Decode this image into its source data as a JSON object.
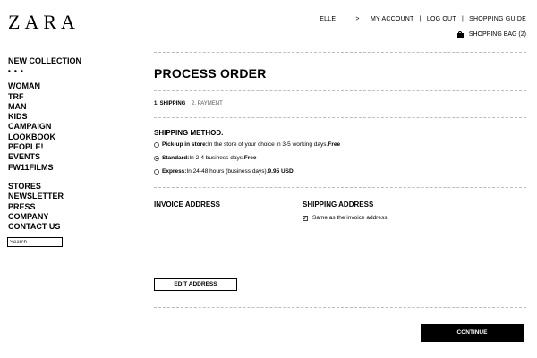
{
  "header": {
    "logo": "ZARA",
    "nav": [
      {
        "label": "ELLE"
      },
      {
        "label": ">",
        "separator": true
      },
      {
        "label": "MY ACCOUNT"
      },
      {
        "label": "|",
        "separator": true
      },
      {
        "label": "LOG OUT"
      },
      {
        "label": "|",
        "separator": true
      },
      {
        "label": "SHOPPING GUIDE"
      }
    ],
    "bag_icon": "shopping-bag-icon",
    "bag_label": "SHOPPING BAG (2)"
  },
  "sidebar": {
    "items": [
      {
        "label": "NEW COLLECTION"
      },
      {
        "label": "• • •"
      },
      {
        "label": "WOMAN"
      },
      {
        "label": "TRF"
      },
      {
        "label": "MAN"
      },
      {
        "label": "KIDS"
      },
      {
        "label": "CAMPAIGN"
      },
      {
        "label": "LOOKBOOK"
      },
      {
        "label": "PEOPLE!"
      },
      {
        "label": "EVENTS"
      },
      {
        "label": "FW11FILMS"
      },
      {
        "label": "STORES"
      },
      {
        "label": "NEWSLETTER"
      },
      {
        "label": "PRESS"
      },
      {
        "label": "COMPANY"
      },
      {
        "label": "CONTACT US"
      }
    ],
    "search_value": "Search..."
  },
  "main": {
    "title": "PROCESS ORDER",
    "steps": {
      "step1": "1. SHIPPING",
      "step2": "2. PAYMENT"
    },
    "shipping_method": {
      "title": "SHIPPING METHOD.",
      "options": [
        {
          "name": "Pick-up in store:",
          "desc": " In the store of your choice in 3-5 working days. ",
          "price": "Free",
          "selected": false
        },
        {
          "name": "Standard:",
          "desc": " In 2-4 business days. ",
          "price": "Free",
          "selected": true
        },
        {
          "name": "Express:",
          "desc": " In 24-48 hours (business days). ",
          "price": "9.95 USD",
          "selected": false
        }
      ]
    },
    "invoice_address_title": "INVOICE ADDRESS",
    "shipping_address_title": "SHIPPING ADDRESS",
    "same_as_invoice_label": "Same as the invoice address",
    "same_as_invoice_checked": true,
    "edit_address_label": "EDIT ADDRESS",
    "continue_label": "CONTINUE"
  }
}
